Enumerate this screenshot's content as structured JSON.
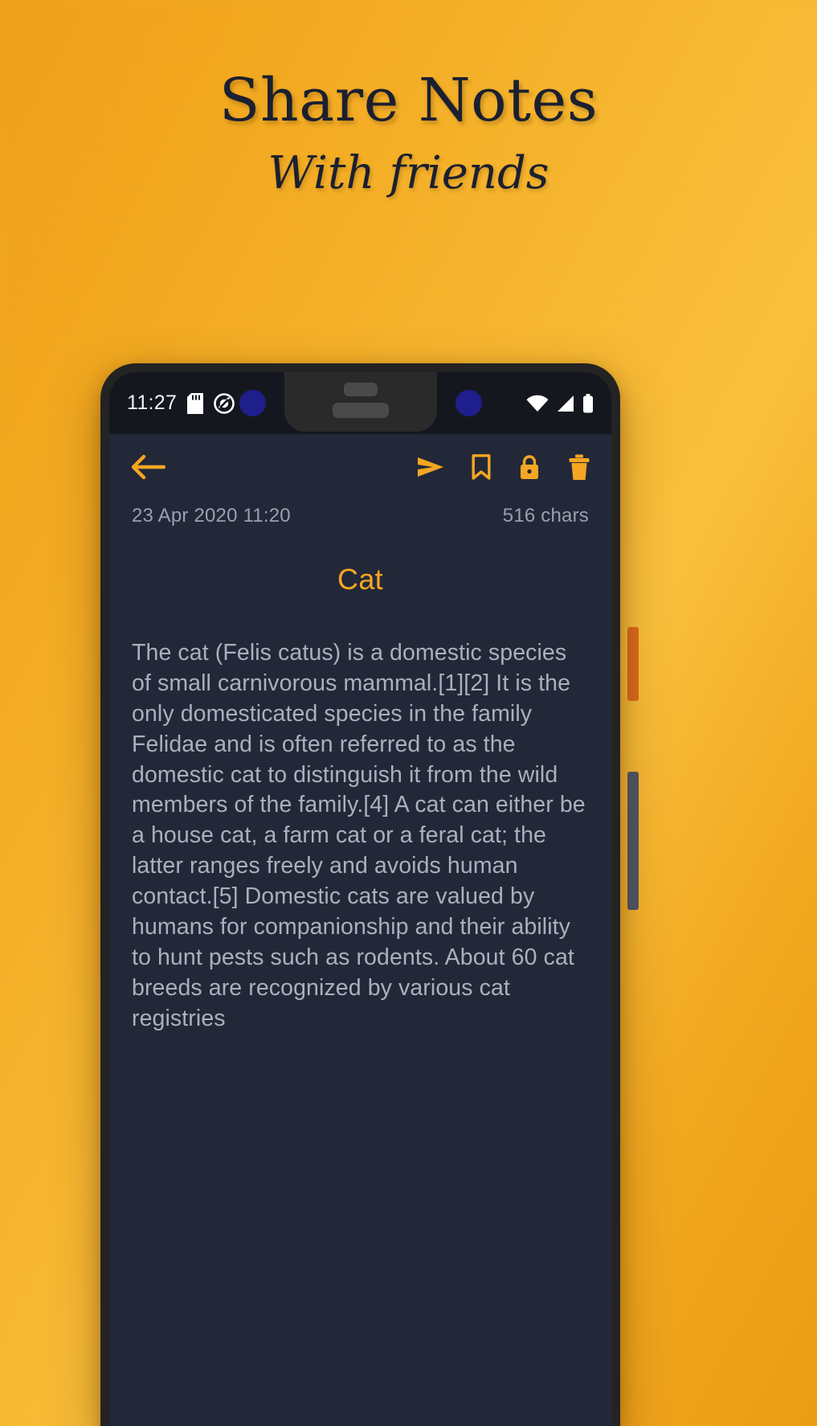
{
  "promo": {
    "title": "Share Notes",
    "subtitle": "With friends"
  },
  "colors": {
    "background_start": "#f0a01c",
    "background_end": "#f9bf3c",
    "accent_orange": "#f5a623",
    "app_background": "#232838",
    "status_bar": "#15171f",
    "body_text": "#aab0bf",
    "meta_text": "#9aa0b0"
  },
  "phone": {
    "status_bar": {
      "time": "11:27",
      "left_icons": [
        "sd-card-icon",
        "do-not-disturb-icon"
      ],
      "right_icons": [
        "wifi-icon",
        "cellular-signal-icon",
        "battery-icon"
      ]
    },
    "app": {
      "toolbar": {
        "back_label": "Back",
        "actions": [
          {
            "name": "send-icon",
            "label": "Send"
          },
          {
            "name": "bookmark-icon",
            "label": "Bookmark"
          },
          {
            "name": "lock-icon",
            "label": "Lock"
          },
          {
            "name": "trash-icon",
            "label": "Delete"
          }
        ]
      },
      "meta": {
        "date": "23 Apr 2020 11:20",
        "chars": "516 chars"
      },
      "note": {
        "title": "Cat",
        "body": "The cat (Felis catus) is a domestic species of small carnivorous mammal.[1][2] It is the only domesticated species in the family Felidae and is often referred to as the domestic cat to distinguish it from the wild members of the family.[4] A cat can either be a house cat, a farm cat or a feral cat; the latter ranges freely and avoids human contact.[5] Domestic cats are valued by humans for companionship and their ability to hunt pests such as rodents. About 60 cat breeds are recognized by various cat registries"
      }
    }
  }
}
